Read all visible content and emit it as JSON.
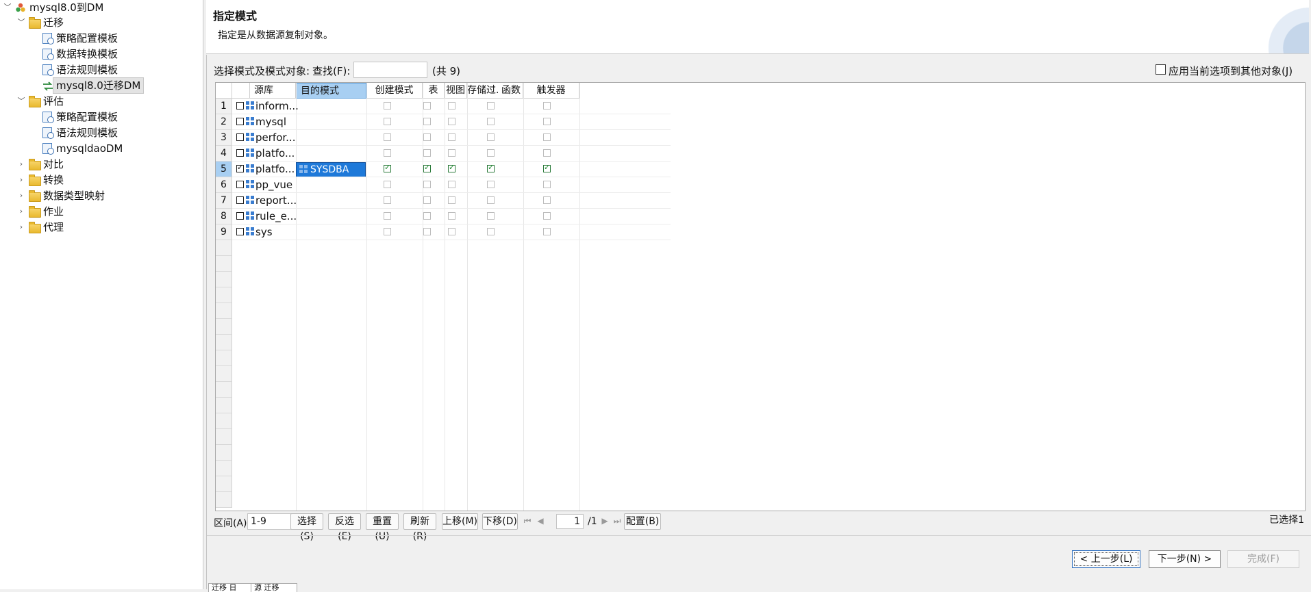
{
  "tree": {
    "root": "mysql8.0到DM",
    "items": [
      {
        "label": "迁移",
        "type": "folder",
        "expanded": true
      },
      {
        "label": "策略配置模板",
        "type": "template"
      },
      {
        "label": "数据转换模板",
        "type": "template"
      },
      {
        "label": "语法规则模板",
        "type": "template"
      },
      {
        "label": "mysql8.0迁移DM",
        "type": "migration",
        "selected": true
      },
      {
        "label": "评估",
        "type": "folder",
        "expanded": true
      },
      {
        "label": "策略配置模板",
        "type": "template"
      },
      {
        "label": "语法规则模板",
        "type": "template"
      },
      {
        "label": "mysqldaoDM",
        "type": "template"
      },
      {
        "label": "对比",
        "type": "folder",
        "expanded": false
      },
      {
        "label": "转换",
        "type": "folder",
        "expanded": false
      },
      {
        "label": "数据类型映射",
        "type": "folder",
        "expanded": false
      },
      {
        "label": "作业",
        "type": "folder",
        "expanded": false
      },
      {
        "label": "代理",
        "type": "folder",
        "expanded": false
      }
    ]
  },
  "header": {
    "title": "指定模式",
    "description": "指定是从数据源复制对象。"
  },
  "filter": {
    "select_label": "选择模式及模式对象:",
    "find_label": "查找(F):",
    "find_value": "",
    "count_label": "(共 9)",
    "apply_label": "应用当前选项到其他对象(J)"
  },
  "grid": {
    "columns": [
      "源库",
      "目的模式",
      "创建模式",
      "表",
      "视图",
      "存储过...",
      "函数",
      "触发器"
    ],
    "rows": [
      {
        "num": "1",
        "name": "inform...",
        "checked": false,
        "target": ""
      },
      {
        "num": "2",
        "name": "mysql",
        "checked": false,
        "target": ""
      },
      {
        "num": "3",
        "name": "perfor...",
        "checked": false,
        "target": ""
      },
      {
        "num": "4",
        "name": "platfo...",
        "checked": false,
        "target": ""
      },
      {
        "num": "5",
        "name": "platfo...",
        "checked": true,
        "target": "SYSDBA"
      },
      {
        "num": "6",
        "name": "pp_vue",
        "checked": false,
        "target": ""
      },
      {
        "num": "7",
        "name": "report...",
        "checked": false,
        "target": ""
      },
      {
        "num": "8",
        "name": "rule_e...",
        "checked": false,
        "target": ""
      },
      {
        "num": "9",
        "name": "sys",
        "checked": false,
        "target": ""
      }
    ],
    "active_row": 5
  },
  "toolbar": {
    "range_label": "区间(A):",
    "range_value": "1-9",
    "select": "选择(S)",
    "invert": "反选(E)",
    "reset": "重置(U)",
    "refresh": "刷新(R)",
    "move_up": "上移(M)",
    "move_down": "下移(D)",
    "page_value": "1",
    "page_total": "/1",
    "config": "配置(B)",
    "selected_count": "已选择1"
  },
  "wizard": {
    "prev": "< 上一步(L)",
    "next": "下一步(N) >",
    "finish": "完成(F)"
  },
  "tabs": [
    "迁移 日",
    "源 迁移"
  ]
}
